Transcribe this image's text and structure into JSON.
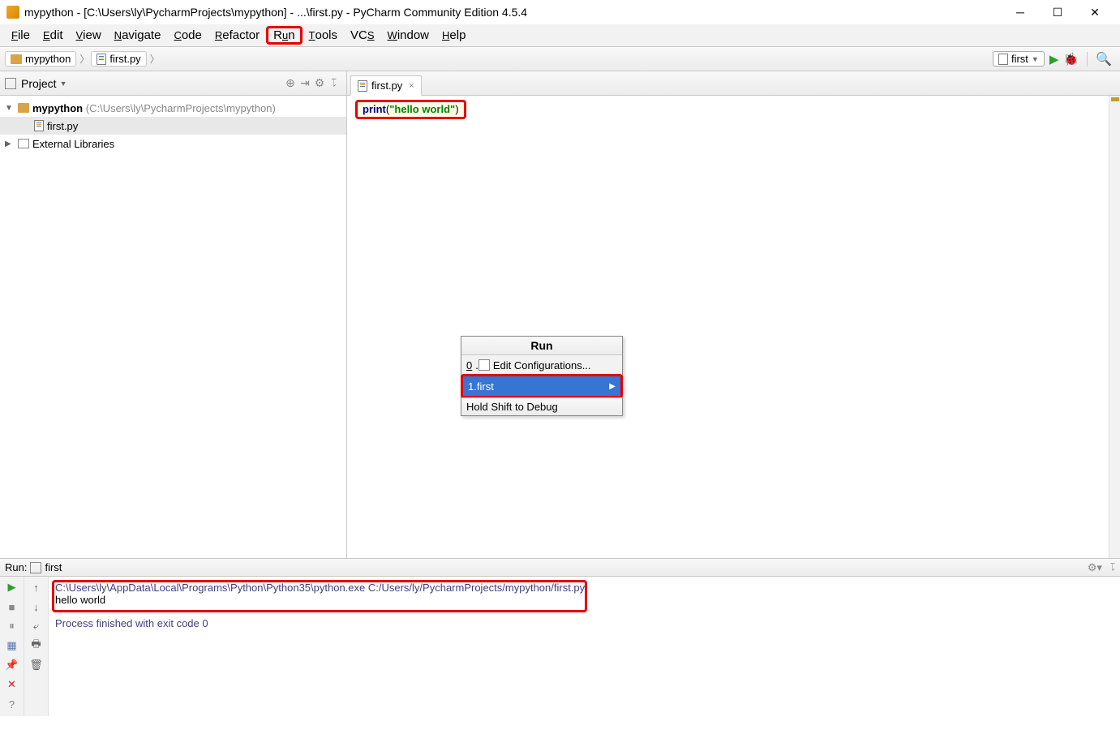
{
  "title": "mypython - [C:\\Users\\ly\\PycharmProjects\\mypython] - ...\\first.py - PyCharm Community Edition 4.5.4",
  "menu": {
    "file": "File",
    "edit": "Edit",
    "view": "View",
    "navigate": "Navigate",
    "code": "Code",
    "refactor": "Refactor",
    "run": "Run",
    "tools": "Tools",
    "vcs": "VCS",
    "window": "Window",
    "help": "Help"
  },
  "breadcrumbs": {
    "project": "mypython",
    "file": "first.py"
  },
  "toolbar": {
    "config": "first"
  },
  "projectPanel": {
    "title": "Project"
  },
  "tree": {
    "root": "mypython",
    "rootPath": "(C:\\Users\\ly\\PycharmProjects\\mypython)",
    "file": "first.py",
    "ext": "External Libraries"
  },
  "tab": {
    "name": "first.py"
  },
  "code": {
    "print": "print",
    "open": "(",
    "s": "\"hello world\"",
    "close": ")"
  },
  "popup": {
    "title": "Run",
    "item0num": "0",
    "item0": "Edit Configurations...",
    "item1num": "1",
    "item1": "first",
    "footer": "Hold Shift to Debug"
  },
  "runHeader": {
    "label": "Run:",
    "name": "first"
  },
  "console": {
    "cmd": "C:\\Users\\ly\\AppData\\Local\\Programs\\Python\\Python35\\python.exe C:/Users/ly/PycharmProjects/mypython/first.py",
    "out": "hello world",
    "exit": "Process finished with exit code 0"
  }
}
